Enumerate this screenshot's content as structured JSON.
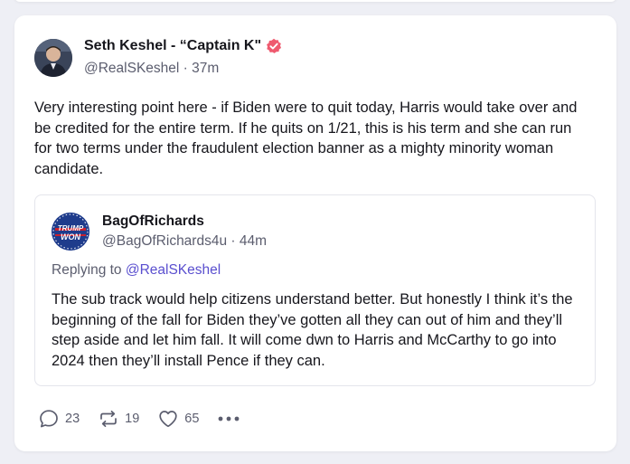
{
  "post": {
    "author_name": "Seth Keshel - “Captain K\"",
    "handle": "@RealSKeshel",
    "separator": " · ",
    "time": "37m",
    "text": "Very interesting point here - if Biden were to quit today, Harris would take over and be credited for the entire term.  If he quits on 1/21, this is his term and she can run for two terms under the fraudulent election banner as a mighty minority woman candidate."
  },
  "quote": {
    "author_name": "BagOfRichards",
    "handle": "@BagOfRichards4u",
    "separator": " · ",
    "time": "44m",
    "replying_prefix": "Replying to ",
    "replying_to": "@RealSKeshel",
    "avatar_text_1": "TRUMP",
    "avatar_text_2": "WON",
    "text": "The sub track would help citizens understand better. But honestly I think it’s the beginning of the fall for Biden they’ve gotten all they can out of him and they’ll step aside and let him fall. It will come dwn to Harris and McCarthy to go into 2024 then they’ll install Pence if they can."
  },
  "actions": {
    "replies": "23",
    "reposts": "19",
    "likes": "65"
  },
  "icons": {
    "verified": "verified-badge-icon",
    "reply": "reply-icon",
    "repost": "repost-icon",
    "like": "heart-icon",
    "more": "more-icon"
  },
  "colors": {
    "accent": "#5a4fcf",
    "verified": "#ef5a6f",
    "background": "#eeeff5"
  }
}
